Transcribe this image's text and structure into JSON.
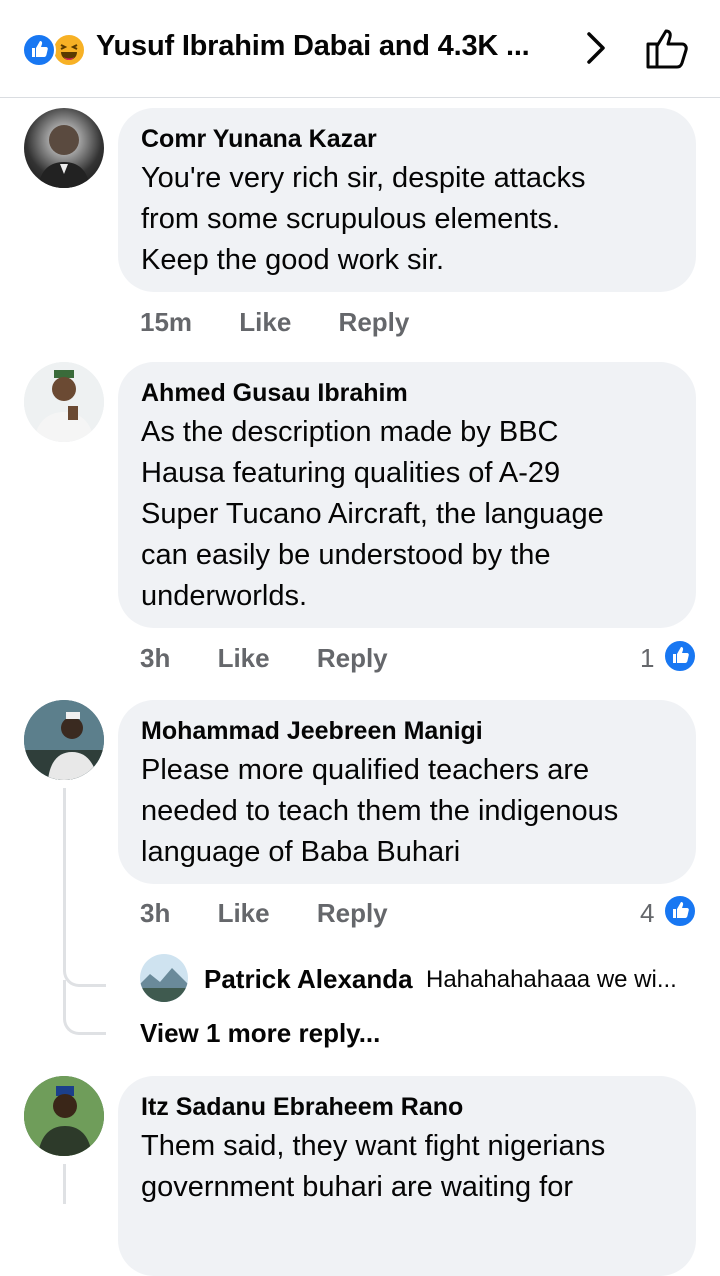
{
  "header": {
    "title": "Yusuf Ibrahim Dabai and 4.3K ...",
    "reaction_icons": [
      "like-reaction-icon",
      "haha-reaction-icon"
    ],
    "nav_icon": "chevron-right-icon",
    "action_icon": "thumbs-up-outline-icon"
  },
  "comments": [
    {
      "author": "Comr Yunana Kazar",
      "lines": [
        "You're very rich sir, despite attacks",
        "from some scrupulous elements.",
        "Keep the good work sir."
      ],
      "time": "15m",
      "like": "Like",
      "reply": "Reply",
      "reactions": null
    },
    {
      "author": "Ahmed Gusau Ibrahim",
      "lines": [
        "As the description made by  BBC",
        "Hausa featuring  qualities of A-29",
        "Super Tucano Aircraft, the language",
        "can easily be understood by the",
        "underworlds."
      ],
      "time": "3h",
      "like": "Like",
      "reply": "Reply",
      "reactions": "1"
    },
    {
      "author": "Mohammad Jeebreen Manigi",
      "lines": [
        "Please more qualified teachers are",
        "needed to teach them the indigenous",
        "language of Baba Buhari"
      ],
      "time": "3h",
      "like": "Like",
      "reply": "Reply",
      "reactions": "4",
      "reply_preview": {
        "author": "Patrick Alexanda",
        "text": "Hahahahahaaa we wi..."
      },
      "view_more": "View 1 more reply..."
    },
    {
      "author": "Itz Sadanu Ebraheem Rano",
      "lines": [
        "Them said,  they want fight nigerians",
        "government buhari are waiting for"
      ]
    }
  ],
  "colors": {
    "accent": "#1877f2",
    "bubble": "#f0f2f5",
    "meta": "#65676b",
    "haha": "#f7b125"
  }
}
